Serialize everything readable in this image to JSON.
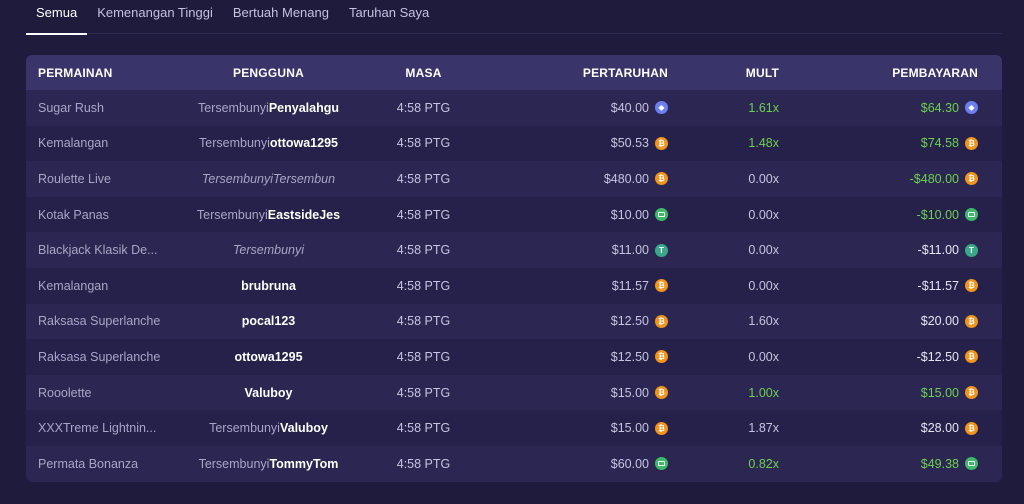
{
  "tabs": [
    "Semua",
    "Kemenangan Tinggi",
    "Bertuah Menang",
    "Taruhan Saya"
  ],
  "headers": {
    "game": "PERMAINAN",
    "user": "PENGGUNA",
    "time": "MASA",
    "bet": "PERTARUHAN",
    "mult": "MULT",
    "pay": "PEMBAYARAN"
  },
  "colors": {
    "win": "#6fcf4f",
    "eth": "#6c7ff0",
    "btc": "#f2951d",
    "cash": "#3fb86a",
    "usdt": "#3aa98a"
  },
  "rows": [
    {
      "game": "Sugar Rush",
      "hidden": "Tersembunyi",
      "user": "Penyalahgu",
      "time": "4:58 PTG",
      "bet": "$40.00",
      "coin": "eth-icon",
      "mult": "1.61x",
      "pay": "$64.30",
      "win": true
    },
    {
      "game": "Kemalangan",
      "hidden": "Tersembunyi",
      "user": "ottowa1295",
      "time": "4:58 PTG",
      "bet": "$50.53",
      "coin": "btc-icon",
      "mult": "1.48x",
      "pay": "$74.58",
      "win": true
    },
    {
      "game": "Roulette Live",
      "hidden": "TersembunyiTersembun",
      "user": "",
      "time": "4:58 PTG",
      "bet": "$480.00",
      "coin": "btc-icon",
      "mult": "0.00x",
      "pay": "-$480.00",
      "win": true
    },
    {
      "game": "Kotak Panas",
      "hidden": "Tersembunyi",
      "user": "EastsideJes",
      "time": "4:58 PTG",
      "bet": "$10.00",
      "coin": "cash-icon",
      "mult": "0.00x",
      "pay": "-$10.00",
      "win": true
    },
    {
      "game": "Blackjack Klasik De...",
      "hidden": "Tersembunyi",
      "user": "",
      "time": "4:58 PTG",
      "bet": "$11.00",
      "coin": "usdt-icon",
      "mult": "0.00x",
      "pay": "-$11.00",
      "win": false
    },
    {
      "game": "Kemalangan",
      "hidden": "",
      "user": "brubruna",
      "time": "4:58 PTG",
      "bet": "$11.57",
      "coin": "btc-icon",
      "mult": "0.00x",
      "pay": "-$11.57",
      "win": false
    },
    {
      "game": "Raksasa Superlanche",
      "hidden": "",
      "user": "pocal123",
      "time": "4:58 PTG",
      "bet": "$12.50",
      "coin": "btc-icon",
      "mult": "1.60x",
      "pay": "$20.00",
      "win": false
    },
    {
      "game": "Raksasa Superlanche",
      "hidden": "",
      "user": "ottowa1295",
      "time": "4:58 PTG",
      "bet": "$12.50",
      "coin": "btc-icon",
      "mult": "0.00x",
      "pay": "-$12.50",
      "win": false
    },
    {
      "game": "Rooolette",
      "hidden": "",
      "user": "Valuboy",
      "time": "4:58 PTG",
      "bet": "$15.00",
      "coin": "btc-icon",
      "mult": "1.00x",
      "pay": "$15.00",
      "win": true
    },
    {
      "game": "XXXTreme Lightnin...",
      "hidden": "Tersembunyi",
      "user": "Valuboy",
      "time": "4:58 PTG",
      "bet": "$15.00",
      "coin": "btc-icon",
      "mult": "1.87x",
      "pay": "$28.00",
      "win": false
    },
    {
      "game": "Permata Bonanza",
      "hidden": "Tersembunyi",
      "user": "TommyTom",
      "time": "4:58 PTG",
      "bet": "$60.00",
      "coin": "cash-icon",
      "mult": "0.82x",
      "pay": "$49.38",
      "win": true
    }
  ]
}
